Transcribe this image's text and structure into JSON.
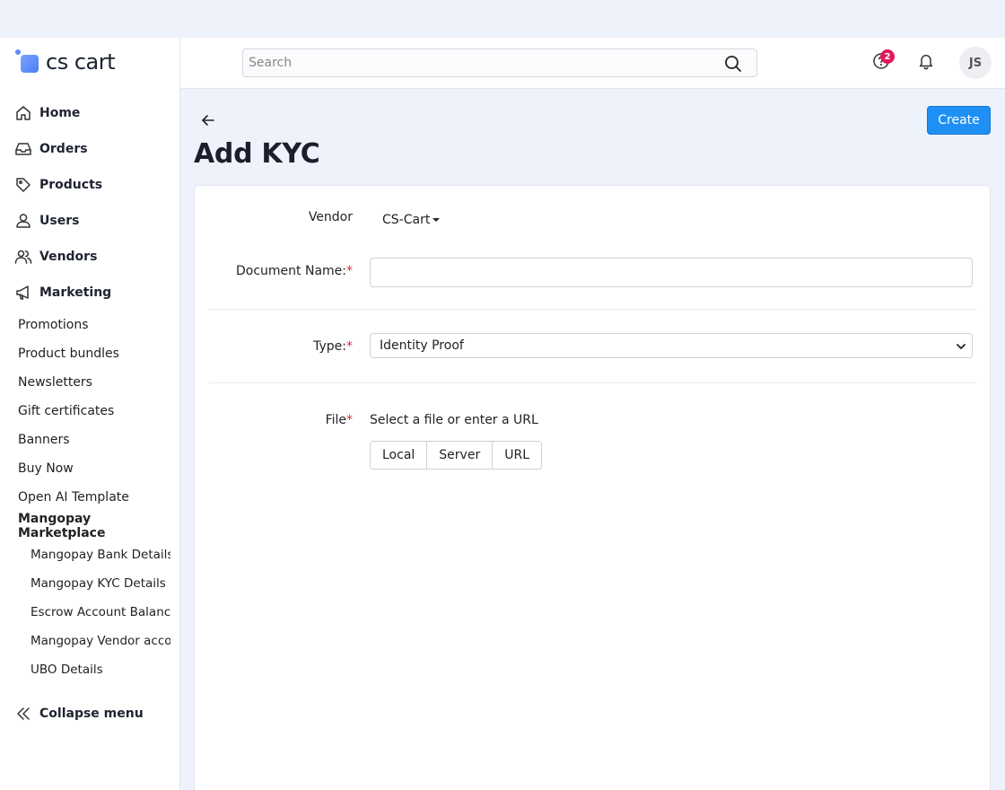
{
  "app": {
    "logo_text": "cs cart"
  },
  "sidebar": {
    "items": [
      {
        "label": "Home",
        "icon": "home-icon"
      },
      {
        "label": "Orders",
        "icon": "inbox-icon"
      },
      {
        "label": "Products",
        "icon": "tag-icon"
      },
      {
        "label": "Users",
        "icon": "user-icon"
      },
      {
        "label": "Vendors",
        "icon": "users-icon"
      },
      {
        "label": "Marketing",
        "icon": "megaphone-icon"
      }
    ],
    "marketing_sub": [
      "Promotions",
      "Product bundles",
      "Newsletters",
      "Gift certificates",
      "Banners",
      "Buy Now",
      "Open AI Template",
      "Mangopay Marketplace"
    ],
    "mangopay_sub": [
      "Mangopay Bank Details",
      "Mangopay KYC Details",
      "Escrow Account Balance",
      "Mangopay Vendor acco…",
      "UBO Details"
    ],
    "collapse_label": "Collapse menu"
  },
  "header": {
    "search_placeholder": "Search",
    "help_badge_count": "2",
    "avatar_initials": "JS"
  },
  "page": {
    "title": "Add KYC",
    "create_label": "Create"
  },
  "form": {
    "vendor_label": "Vendor",
    "vendor_value": "CS-Cart",
    "document_name_label": "Document Name:",
    "document_name_value": "",
    "type_label": "Type:",
    "type_value": "Identity Proof",
    "file_label": "File",
    "file_hint": "Select a file or enter a URL",
    "file_sources": [
      "Local",
      "Server",
      "URL"
    ],
    "required_mark": "*"
  },
  "colors": {
    "accent": "#1e90f5",
    "badge": "#e01a5b",
    "required": "#e0263a",
    "background": "#eef2fa"
  }
}
